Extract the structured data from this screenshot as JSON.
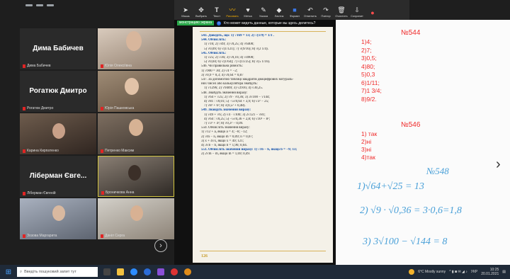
{
  "toolbar": {
    "items": [
      {
        "label": "Мышь",
        "icon": "mouse-icon"
      },
      {
        "label": "Выбрать",
        "icon": "select-icon"
      },
      {
        "label": "Текст",
        "icon": "text-icon"
      },
      {
        "label": "Рисовать",
        "icon": "draw-icon",
        "active": true
      },
      {
        "label": "Метка",
        "icon": "stamp-icon"
      },
      {
        "label": "Указка",
        "icon": "spotlight-icon"
      },
      {
        "label": "Ластик",
        "icon": "eraser-icon"
      },
      {
        "label": "Формат",
        "icon": "format-icon"
      },
      {
        "label": "Отменить",
        "icon": "undo-icon"
      },
      {
        "label": "Повтор",
        "icon": "redo-icon"
      },
      {
        "label": "Очистить",
        "icon": "clear-icon"
      },
      {
        "label": "Сохранит",
        "icon": "save-icon"
      },
      {
        "label": "",
        "icon": "close-icon",
        "red": true
      }
    ]
  },
  "notice": {
    "sharing": "монстрацию экрана",
    "question": "Кто может видеть данные, которые вы здесь делитесь?"
  },
  "participants": [
    {
      "big": "Дима Бабичев",
      "label": "Дима Бабичев"
    },
    {
      "label": "Юлія Олексіївна"
    },
    {
      "big": "Рогатюк Дмитро",
      "label": "Рогатюк Дмитро"
    },
    {
      "label": "Юрiя Пашковська"
    },
    {
      "label": "Карина Кирпатенко"
    },
    {
      "label": "Петренко Максим"
    },
    {
      "big": "Ліберман Євге...",
      "label": "Ліберман Євгеній"
    },
    {
      "label": "Броничкова Анна"
    },
    {
      "label": "Зозова Маргарита"
    },
    {
      "label": "Даніл Серга"
    }
  ],
  "book": {
    "lines": [
      {
        "t": "543. Доведіть, що: 1) √169 = 13;      2) √(1/9) = 1/3 .",
        "ex": true
      },
      {
        "t": "544. Обчисліть:",
        "ex": true
      },
      {
        "t": "1) √16;      2) √49;      3) √0,25;      4) √6400;"
      },
      {
        "t": "5) √0,09;    6) √(1/121);   7) √(9/16);    8) √(2 1/4)."
      },
      {
        "t": "545. Обчисліть:",
        "ex": true
      },
      {
        "t": "1) √25;      2) √36;      3) √0,16;      4) √4900;"
      },
      {
        "t": "5) √0,04;    6) √(1/64);    7) √(11/25);   8) √(5 1/16)."
      },
      {
        "t": "546. Чи правильна рівність:"
      },
      {
        "t": "1) √900 = 30;       2) √4 = −2;"
      },
      {
        "t": "3) √0,9 = 0,3;      4) √0,64 = 0,87"
      },
      {
        "t": "547. За допомогою таблиці квадратів двоцифрових натураль-"
      },
      {
        "t": "них чисел або калькулятора знайдіть:"
      },
      {
        "t": "1) √1296;     2) √9409;     3) √2916;     4) √30,25."
      },
      {
        "t": "548. Знайдіть значення виразу:"
      },
      {
        "t": "1) √64 + √25;     2) √9 · √0,36;      3) 3√100 − √144;"
      },
      {
        "t": "4) √81 : √0,01;   5) −5√0,64 + 3,9;   6) √3² − 25;"
      },
      {
        "t": "7) √8² + 6²;       8) √(0,5² + 0,48)."
      },
      {
        "t": "549. Знайдіть значення виразу:",
        "ex": true
      },
      {
        "t": "1) √49 + √6;      2) √4 · √100;      3) 2√121 − √81;"
      },
      {
        "t": "4) √64 : √0,25;   5) −5√0,36 + 2,8;  6) √10² − 8²;"
      },
      {
        "t": "7) √3² + 4²;       8) √0,3² − 0,09."
      },
      {
        "t": "550. Обчисліть значення виразу:"
      },
      {
        "t": "1) √12 + a, якщо a = 4; −8; −12;"
      },
      {
        "t": "2) √m − n, якщо m = 0,09; n = 0,07;"
      },
      {
        "t": "3) x + 4√x, якщо x = 49; 121;"
      },
      {
        "t": "4) 3√b − b, якщо b = 1,96; 0,04."
      },
      {
        "t": "551. Обчисліть значення виразу: 1) √16 − b, якщо b = −9; 13;",
        "ex": true
      },
      {
        "t": "2) 2√m − m, якщо m = 1,69; 0,49."
      }
    ],
    "page_number": "126"
  },
  "whiteboard": {
    "title544": "№544",
    "answers544": [
      "1)4;",
      "2)7;",
      "3)0,5;",
      "4)80;",
      "5)0,3",
      "6)1/11;",
      "7)1 3/4;",
      "8)9/2."
    ],
    "title546": "№546",
    "answers546": [
      "1) так",
      "2)ні",
      "3)ні",
      "4)так"
    ],
    "hw548": "№548",
    "hw1": "1)√64+√25 = 13",
    "hw2": "2) √9 · √0,36 = 3·0,6=1,8",
    "hw3": "3) 3√100 − √144 = 8"
  },
  "taskbar": {
    "search_placeholder": "Введіть пошуковий запит тут",
    "weather": "6°C  Mostly sunny",
    "lang": "УКР",
    "time": "10:25",
    "date": "20.01.2021"
  }
}
